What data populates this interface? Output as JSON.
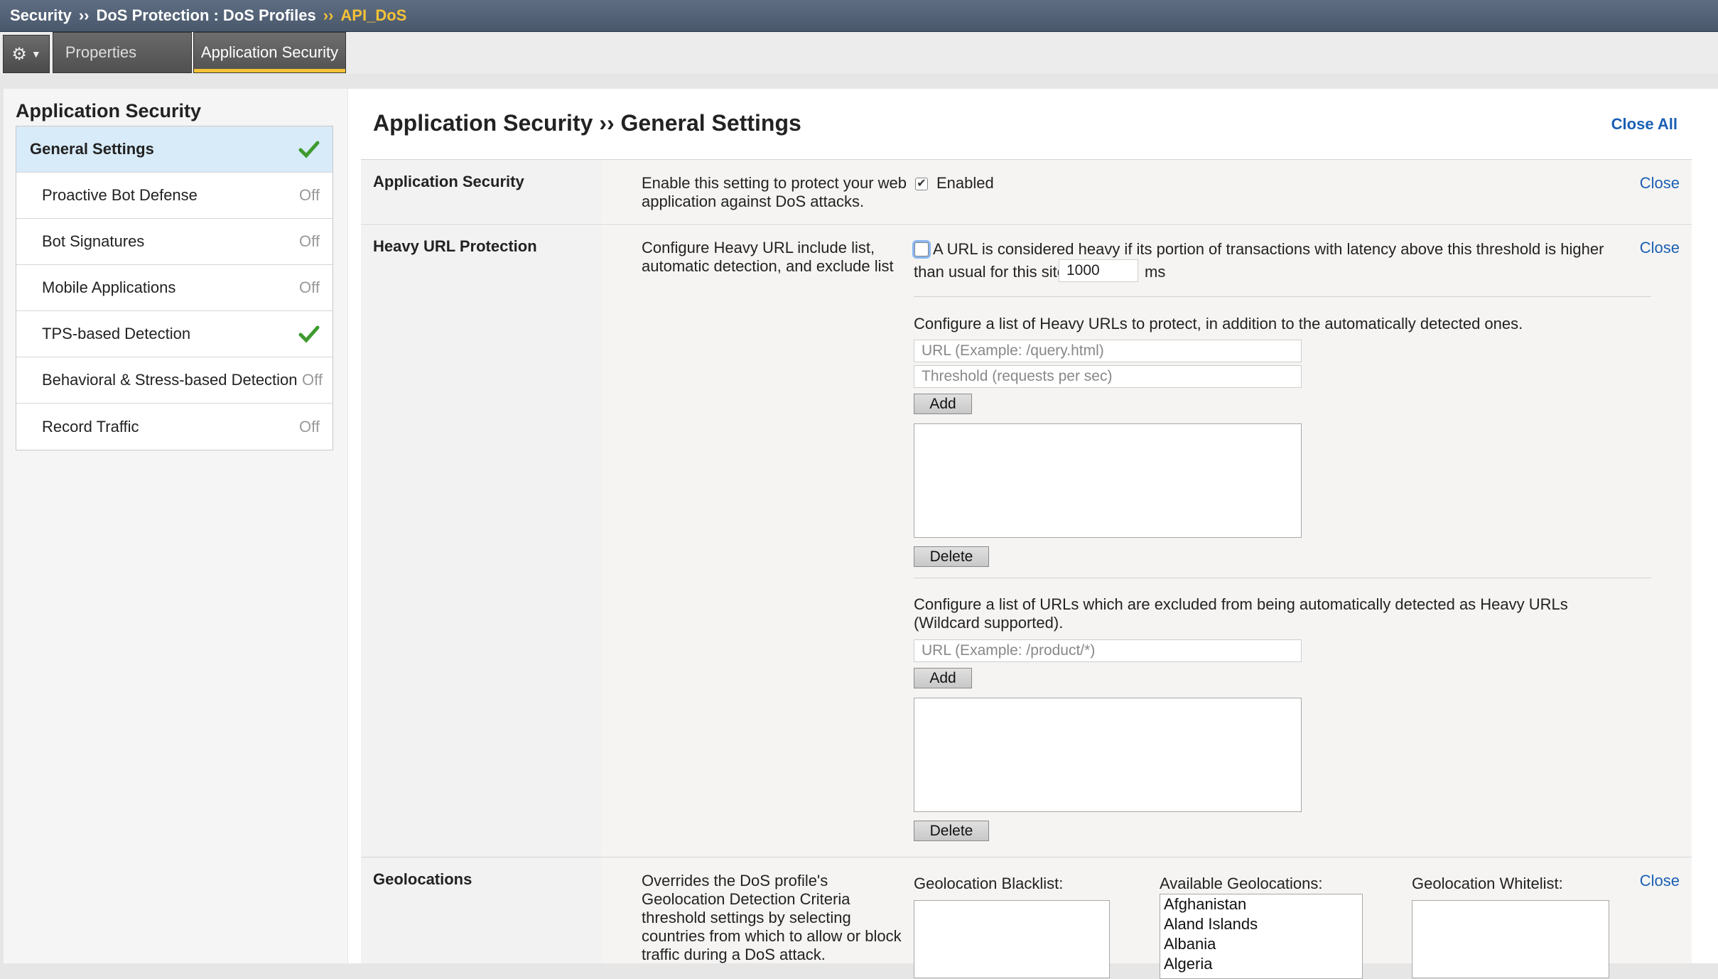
{
  "breadcrumb": {
    "items": [
      "Security",
      "DoS Protection : DoS Profiles"
    ],
    "separator": "››",
    "current": "API_DoS"
  },
  "tabs": {
    "properties": "Properties",
    "application_security": "Application Security"
  },
  "sidebar": {
    "title": "Application Security",
    "items": [
      {
        "label": "General Settings",
        "status": "check",
        "selected": true
      },
      {
        "label": "Proactive Bot Defense",
        "status": "Off"
      },
      {
        "label": "Bot Signatures",
        "status": "Off"
      },
      {
        "label": "Mobile Applications",
        "status": "Off"
      },
      {
        "label": "TPS-based Detection",
        "status": "check"
      },
      {
        "label": "Behavioral & Stress-based Detection",
        "status": "Off"
      },
      {
        "label": "Record Traffic",
        "status": "Off"
      }
    ]
  },
  "main": {
    "title": "Application Security ›› General Settings",
    "close_all": "Close All",
    "close_label": "Close",
    "app_security": {
      "label": "Application Security",
      "desc": "Enable this setting to protect your web application against DoS attacks.",
      "enabled_label": "Enabled",
      "enabled": true
    },
    "heavy_url": {
      "label": "Heavy URL Protection",
      "desc": "Configure Heavy URL include list, automatic detection, and exclude list",
      "threshold_text_1": "A URL is considered heavy if its portion of transactions with latency above this threshold is higher",
      "threshold_text_2": "than usual for this site.",
      "threshold_value": "1000",
      "threshold_unit": "ms",
      "include_text": "Configure a list of Heavy URLs to protect, in addition to the automatically detected ones.",
      "url_placeholder": "URL (Example: /query.html)",
      "threshold_placeholder": "Threshold (requests per sec)",
      "add_label": "Add",
      "delete_label": "Delete",
      "exclude_text": "Configure a list of URLs which are excluded from being automatically detected as Heavy URLs (Wildcard supported).",
      "exclude_placeholder": "URL (Example: /product/*)"
    },
    "geolocations": {
      "label": "Geolocations",
      "desc": "Overrides the DoS profile's Geolocation Detection Criteria threshold settings by selecting countries from which to allow or block traffic during a DoS attack.",
      "blacklist_label": "Geolocation Blacklist:",
      "available_label": "Available Geolocations:",
      "whitelist_label": "Geolocation Whitelist:",
      "available": [
        "Afghanistan",
        "Aland Islands",
        "Albania",
        "Algeria"
      ]
    }
  }
}
